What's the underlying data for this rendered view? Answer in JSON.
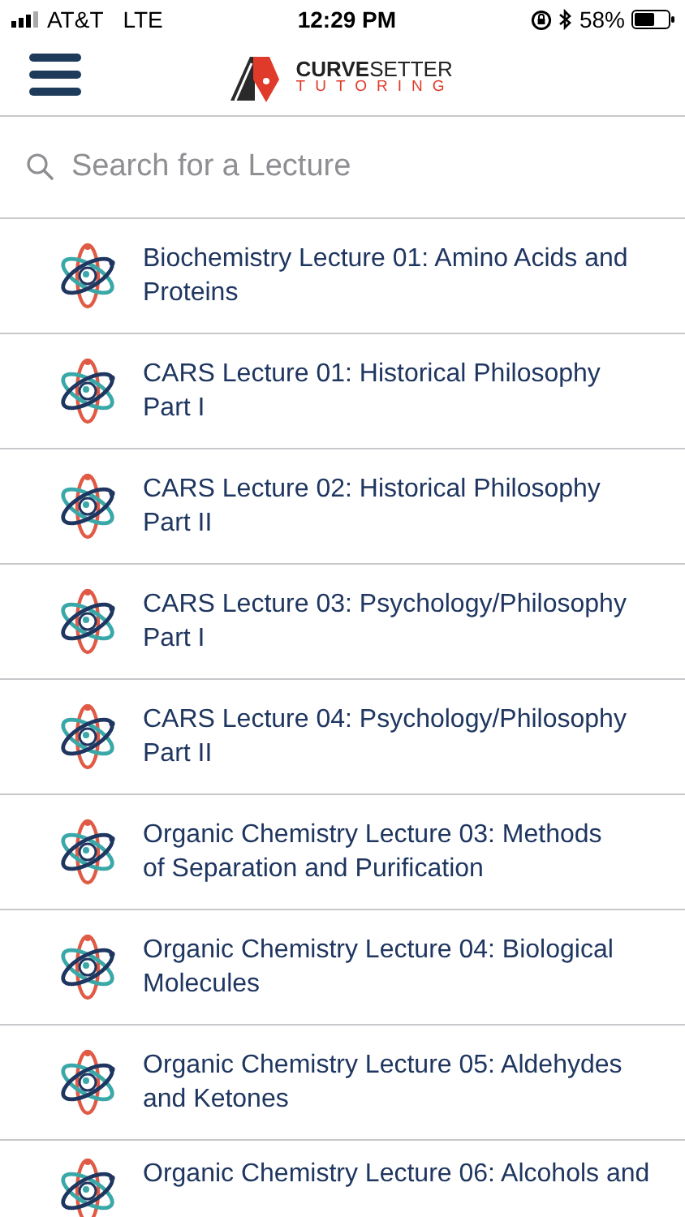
{
  "status_bar": {
    "carrier": "AT&T",
    "network": "LTE",
    "time": "12:29 PM",
    "battery": "58%"
  },
  "header": {
    "logo_title": "**CURVE**SETTER",
    "logo_subtitle": "TUTORING"
  },
  "search": {
    "placeholder": "Search for a Lecture"
  },
  "lectures": [
    {
      "title": "Biochemistry Lecture 01: Amino Acids and Proteins"
    },
    {
      "title": "CARS Lecture 01: Historical Philosophy Part I"
    },
    {
      "title": "CARS Lecture 02: Historical Philosophy Part II"
    },
    {
      "title": "CARS Lecture 03: Psychology/Philosophy Part I"
    },
    {
      "title": "CARS Lecture 04: Psychology/Philosophy Part II"
    },
    {
      "title": "Organic Chemistry Lecture 03: Methods of Separation and Purification"
    },
    {
      "title": "Organic Chemistry Lecture 04: Biological Molecules"
    },
    {
      "title": "Organic Chemistry Lecture 05: Aldehydes and Ketones"
    },
    {
      "title": "Organic Chemistry Lecture 06: Alcohols and"
    }
  ]
}
